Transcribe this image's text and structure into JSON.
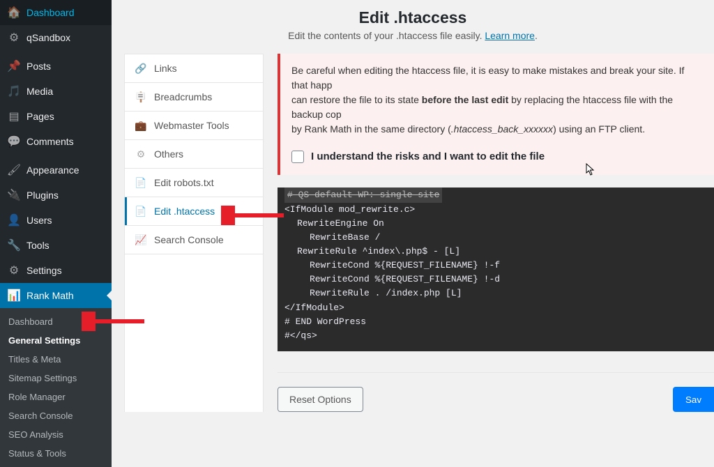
{
  "header": {
    "title": "Edit .htaccess",
    "subtitle_pre": "Edit the contents of your .htaccess file easily. ",
    "learn_more": "Learn more"
  },
  "sidebar": {
    "items": [
      {
        "label": "Dashboard",
        "icon": "dashboard"
      },
      {
        "label": "qSandbox",
        "icon": "gear"
      },
      {
        "label": "Posts",
        "icon": "pin"
      },
      {
        "label": "Media",
        "icon": "media"
      },
      {
        "label": "Pages",
        "icon": "page"
      },
      {
        "label": "Comments",
        "icon": "comment"
      },
      {
        "label": "Appearance",
        "icon": "brush"
      },
      {
        "label": "Plugins",
        "icon": "plug"
      },
      {
        "label": "Users",
        "icon": "user"
      },
      {
        "label": "Tools",
        "icon": "wrench"
      },
      {
        "label": "Settings",
        "icon": "sliders"
      },
      {
        "label": "Rank Math",
        "icon": "chart",
        "active": true
      }
    ],
    "submenu": [
      {
        "label": "Dashboard"
      },
      {
        "label": "General Settings",
        "current": true
      },
      {
        "label": "Titles & Meta"
      },
      {
        "label": "Sitemap Settings"
      },
      {
        "label": "Role Manager"
      },
      {
        "label": "Search Console"
      },
      {
        "label": "SEO Analysis"
      },
      {
        "label": "Status & Tools"
      }
    ]
  },
  "tabs": [
    {
      "label": "Links",
      "icon": "link"
    },
    {
      "label": "Breadcrumbs",
      "icon": "signpost"
    },
    {
      "label": "Webmaster Tools",
      "icon": "briefcase"
    },
    {
      "label": "Others",
      "icon": "settings"
    },
    {
      "label": "Edit robots.txt",
      "icon": "doc"
    },
    {
      "label": "Edit .htaccess",
      "icon": "doc",
      "active": true
    },
    {
      "label": "Search Console",
      "icon": "chart"
    }
  ],
  "notice": {
    "line1_a": "Be careful when editing the htaccess file, it is easy to make mistakes and break your site. If that happ",
    "line1_b": "can restore the file to its state ",
    "line1_strong": "before the last edit",
    "line1_c": " by replacing the htaccess file with the backup cop",
    "line2_a": "by Rank Math in the same directory (",
    "line2_em": ".htaccess_back_xxxxxx",
    "line2_b": ") using an FTP client.",
    "checkbox_label": "I understand the risks and I want to edit the file"
  },
  "code": {
    "l0": "# QS default WP: single site",
    "l1": "<IfModule mod_rewrite.c>",
    "l2": "RewriteEngine On",
    "l3": "RewriteBase /",
    "l4": "RewriteRule ^index\\.php$ - [L]",
    "l5": "RewriteCond %{REQUEST_FILENAME} !-f",
    "l6": "RewriteCond %{REQUEST_FILENAME} !-d",
    "l7": "RewriteRule . /index.php [L]",
    "l8": "</IfModule>",
    "l9": "# END WordPress",
    "l10": "#</qs>"
  },
  "buttons": {
    "reset": "Reset Options",
    "save": "Sav"
  }
}
